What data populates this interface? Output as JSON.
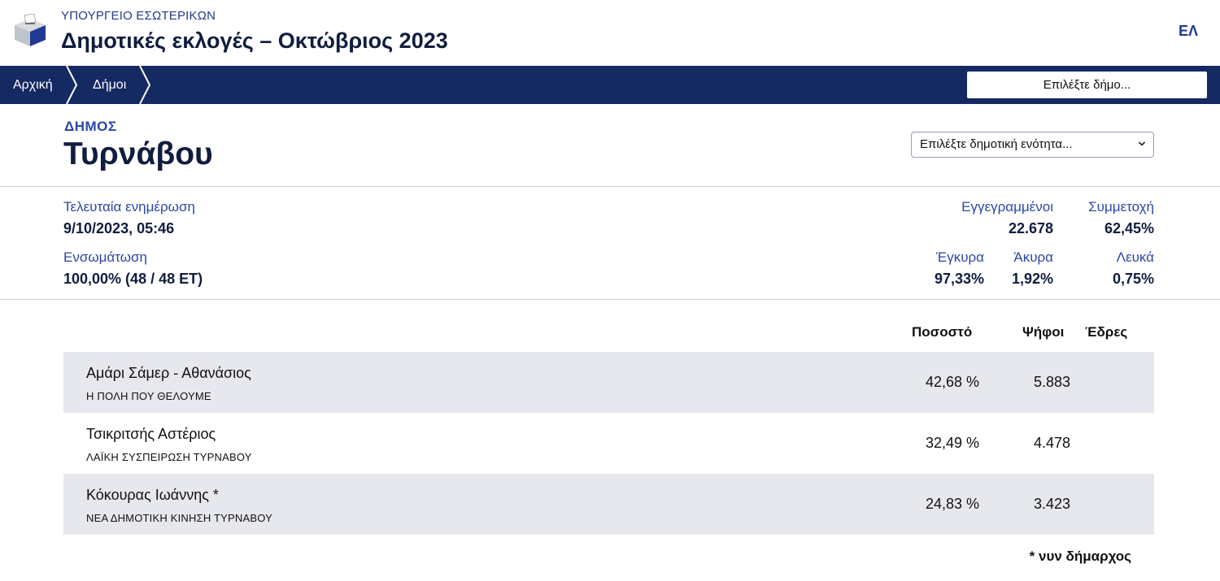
{
  "header": {
    "ministry": "ΥΠΟΥΡΓΕΙΟ ΕΣΩΤΕΡΙΚΩΝ",
    "title": "Δημοτικές εκλογές – Οκτώβριος 2023",
    "language": "ΕΛ",
    "logo_icon": "ballot-box-icon"
  },
  "nav": {
    "breadcrumbs": [
      "Αρχική",
      "Δήμοι"
    ],
    "municipality_search_placeholder": "Επιλέξτε δήμο..."
  },
  "municipality": {
    "kind": "ΔΗΜΟΣ",
    "name": "Τυρνάβου",
    "unit_select_value": "Επιλέξτε δημοτική ενότητα..."
  },
  "stats": {
    "last_update_label": "Τελευταία ενημέρωση",
    "last_update_value": "9/10/2023, 05:46",
    "integration_label": "Ενσωμάτωση",
    "integration_value": "100,00% (48 / 48 ΕΤ)",
    "registered_label": "Εγγεγραμμένοι",
    "registered_value": "22.678",
    "turnout_label": "Συμμετοχή",
    "turnout_value": "62,45%",
    "valid_label": "Έγκυρα",
    "valid_value": "97,33%",
    "invalid_label": "Άκυρα",
    "invalid_value": "1,92%",
    "blank_label": "Λευκά",
    "blank_value": "0,75%"
  },
  "results": {
    "columns": [
      "Ποσοστό",
      "Ψήφοι",
      "Έδρες"
    ],
    "rows": [
      {
        "name": "Αμάρι Σάμερ - Αθανάσιος",
        "party": "Η ΠΟΛΗ ΠΟΥ ΘΕΛΟΥΜΕ",
        "percent": "42,68 %",
        "votes": "5.883"
      },
      {
        "name": "Τσικριτσής Αστέριος",
        "party": "ΛΑΪΚΗ ΣΥΣΠΕΙΡΩΣΗ ΤΥΡΝΑΒΟΥ",
        "percent": "32,49 %",
        "votes": "4.478"
      },
      {
        "name": "Κόκουρας Ιωάννης *",
        "party": "ΝΕΑ ΔΗΜΟΤΙΚΗ ΚΙΝΗΣΗ ΤΥΡΝΑΒΟΥ",
        "percent": "24,83 %",
        "votes": "3.423"
      }
    ],
    "footnote": "* νυν δήμαρχος"
  },
  "colors": {
    "navy": "#152962",
    "accent_blue": "#2a47a6",
    "row_shade": "#e6e8ed"
  }
}
